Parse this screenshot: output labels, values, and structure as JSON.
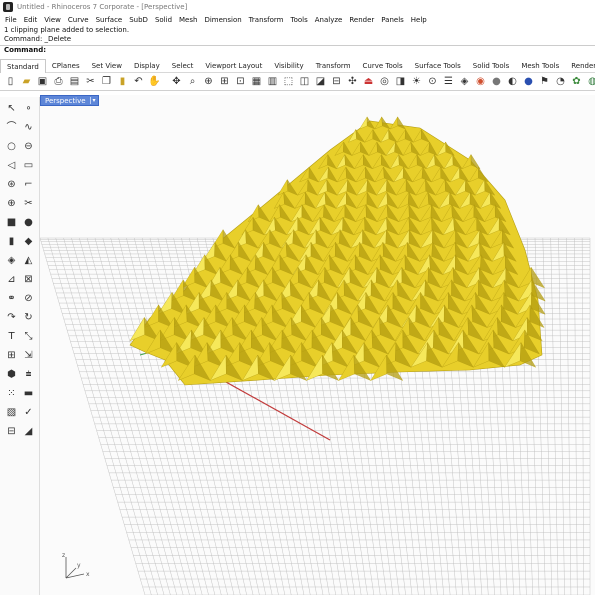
{
  "window": {
    "title": "Untitled - Rhinoceros 7 Corporate - [Perspective]"
  },
  "menubar": {
    "items": [
      "File",
      "Edit",
      "View",
      "Curve",
      "Surface",
      "SubD",
      "Solid",
      "Mesh",
      "Dimension",
      "Transform",
      "Tools",
      "Analyze",
      "Render",
      "Panels",
      "Help"
    ]
  },
  "command_history": {
    "lines": [
      "1 clipping plane added to selection.",
      "Command: _Delete"
    ],
    "prompt": "Command:"
  },
  "toolbar_tabs": {
    "active": "Standard",
    "items": [
      "Standard",
      "CPlanes",
      "Set View",
      "Display",
      "Select",
      "Viewport Layout",
      "Visibility",
      "Transform",
      "Curve Tools",
      "Surface Tools",
      "Solid Tools",
      "Mesh Tools",
      "Render Tools"
    ]
  },
  "viewport": {
    "name": "Perspective",
    "axis_labels": {
      "x": "x",
      "y": "y",
      "z": "z"
    },
    "colors": {
      "model_fill": "#e8cf2a",
      "model_light": "#f6e85a",
      "model_dark": "#b39c10",
      "grid": "#bdbdbd",
      "x_axis": "#c23b3b",
      "y_axis": "#3fa34d",
      "viewport_tab": "#5d86d8"
    }
  }
}
